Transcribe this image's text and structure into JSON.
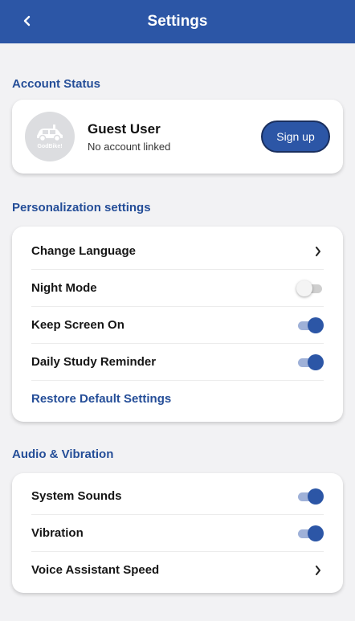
{
  "header": {
    "title": "Settings"
  },
  "account": {
    "section_title": "Account Status",
    "avatar_text": "GodBike!",
    "name": "Guest User",
    "status": "No account linked",
    "signup_label": "Sign up"
  },
  "personalization": {
    "section_title": "Personalization settings",
    "change_language": "Change Language",
    "night_mode": {
      "label": "Night Mode",
      "enabled": false
    },
    "keep_screen_on": {
      "label": "Keep Screen On",
      "enabled": true
    },
    "daily_reminder": {
      "label": "Daily Study Reminder",
      "enabled": true
    },
    "restore_label": "Restore Default Settings"
  },
  "audio": {
    "section_title": "Audio & Vibration",
    "system_sounds": {
      "label": "System Sounds",
      "enabled": true
    },
    "vibration": {
      "label": "Vibration",
      "enabled": true
    },
    "voice_speed": "Voice Assistant Speed"
  },
  "colors": {
    "primary": "#2c56a6",
    "section_title": "#254e98",
    "background": "#f2f2f4"
  }
}
